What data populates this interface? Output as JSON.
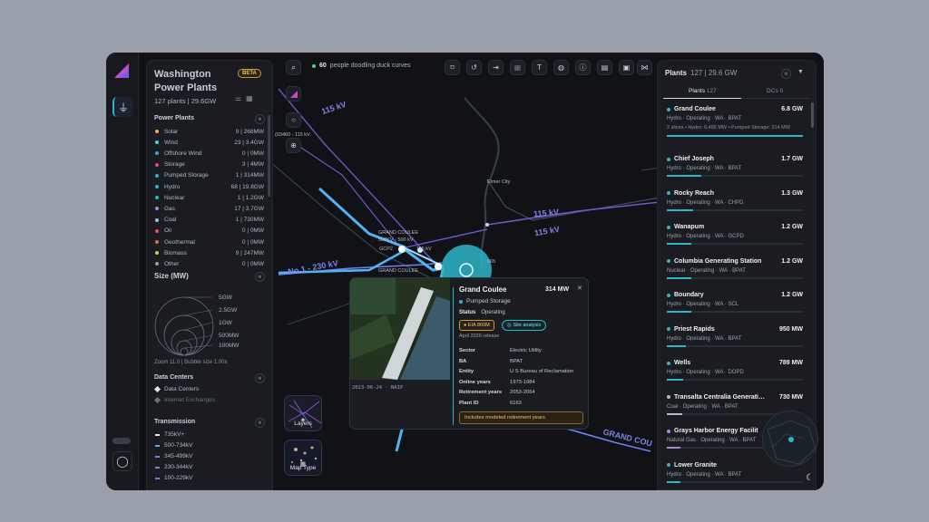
{
  "app": {
    "title_line1": "Washington",
    "title_line2": "Power Plants",
    "beta": "BETA",
    "subtitle": "127 plants | 29.6GW"
  },
  "colors": {
    "accent": "#2bb6c9",
    "transmission": "#7b86e6",
    "warning": "#f0c36a",
    "online": "#3ddc84"
  },
  "rail": {
    "pin_icon": "transmission-tower-icon",
    "user_icon": "user-icon"
  },
  "toolbar": {
    "online_count": "60",
    "online_text": "people doodling duck curves"
  },
  "left_panel": {
    "power_plants_header": "Power Plants",
    "sources": [
      {
        "label": "Solar",
        "value": "9 | 268MW",
        "color": "#f2b233"
      },
      {
        "label": "Wind",
        "value": "23 | 3.4GW",
        "color": "#4fd1e0"
      },
      {
        "label": "Offshore Wind",
        "value": "0 | 0MW",
        "color": "#3fa3d8"
      },
      {
        "label": "Storage",
        "value": "3 | 4MW",
        "color": "#e0479c"
      },
      {
        "label": "Pumped Storage",
        "value": "1 | 314MW",
        "color": "#2bb6c9"
      },
      {
        "label": "Hydro",
        "value": "68 | 19.8GW",
        "color": "#2bb6c9"
      },
      {
        "label": "Nuclear",
        "value": "1 | 1.2GW",
        "color": "#2bb6c9"
      },
      {
        "label": "Gas",
        "value": "17 | 3.7GW",
        "color": "#a786e8"
      },
      {
        "label": "Coal",
        "value": "1 | 730MW",
        "color": "#b7bcc6"
      },
      {
        "label": "Oil",
        "value": "0 | 0MW",
        "color": "#e25555"
      },
      {
        "label": "Geothermal",
        "value": "0 | 0MW",
        "color": "#c97c3a"
      },
      {
        "label": "Biomass",
        "value": "9 | 247MW",
        "color": "#b8d94a"
      },
      {
        "label": "Other",
        "value": "0 | 0MW",
        "color": "#9aa0aa"
      }
    ],
    "size_header": "Size (MW)",
    "size_labels": [
      "5GW",
      "2.5GW",
      "1GW",
      "500MW",
      "100MW"
    ],
    "zoom_text": "Zoom 11.0 | Bubble size 1.00x",
    "dc_header": "Data Centers",
    "dc_items": [
      {
        "label": "Data Centers",
        "color": "#e6e8ee"
      },
      {
        "label": "Internet Exchanges",
        "color": "#6d717b"
      }
    ],
    "tx_header": "Transmission",
    "tx_items": [
      {
        "label": "735kV+",
        "color": "#e6e8ee"
      },
      {
        "label": "500-734kV",
        "color": "#4fb3f5"
      },
      {
        "label": "345-499kV",
        "color": "#6d83f0"
      },
      {
        "label": "230-344kV",
        "color": "#7a7de8"
      },
      {
        "label": "100-229kV",
        "color": "#8a6ae0"
      }
    ]
  },
  "map": {
    "labels": {
      "kv115_a": "115 kV",
      "kv115_b": "115 kV",
      "kv115_c": "115 kV",
      "kv230": "No 1 - 230 kV",
      "grand_coulee_line": "GRAND COU",
      "sub1_a": "GRAND COULEE",
      "sub1_b": "500KV - 500 kV",
      "sub2": "GCP2",
      "sub2_kv": "115 kV",
      "sub3": "GRAND COULEE",
      "small1": "(03460 - 115 kV",
      "city": "Elmer City",
      "num": "065"
    },
    "layers_label": "Layers",
    "map_type_label": "Map Type"
  },
  "popup": {
    "title": "Grand Coulee",
    "capacity": "314 MW",
    "type": "Pumped Storage",
    "status_key": "Status",
    "status_val": "Operating",
    "eia_tag": "EIA 860M",
    "site_tag": "Site analysis",
    "release": "April 2026 release",
    "image_caption": "2023-06-24 · NAIP",
    "fields": [
      {
        "k": "Sector",
        "v": "Electric Utility"
      },
      {
        "k": "BA",
        "v": "BPAT"
      },
      {
        "k": "Entity",
        "v": "U S Bureau of Reclamation"
      },
      {
        "k": "Online years",
        "v": "1973-1984"
      },
      {
        "k": "Retirement years",
        "v": "2053-2064"
      },
      {
        "k": "Plant ID",
        "v": "6163"
      }
    ],
    "note": "Includes modeled retirement years"
  },
  "right_panel": {
    "title": "Plants",
    "title_meta": "127 | 29.6 GW",
    "tab_plants": "Plants",
    "tab_plants_count": "127",
    "tab_dcs": "DCs",
    "tab_dcs_count": "0",
    "plants": [
      {
        "name": "Grand Coulee",
        "cap": "6.8 GW",
        "meta": "Hydro · Operating · WA · BPAT",
        "extra": "2 slices • Hydro: 6,495 MW • Pumped Storage: 314 MW",
        "color": "#2bb6c9",
        "share": 1.0
      },
      {
        "name": "Chief Joseph",
        "cap": "1.7 GW",
        "meta": "Hydro · Operating · WA · BPAT",
        "extra": "",
        "color": "#2bb6c9",
        "share": 0.25
      },
      {
        "name": "Rocky Reach",
        "cap": "1.3 GW",
        "meta": "Hydro · Operating · WA · CHPD",
        "extra": "",
        "color": "#2bb6c9",
        "share": 0.19
      },
      {
        "name": "Wanapum",
        "cap": "1.2 GW",
        "meta": "Hydro · Operating · WA · GCPD",
        "extra": "",
        "color": "#2bb6c9",
        "share": 0.18
      },
      {
        "name": "Columbia Generating Station",
        "cap": "1.2 GW",
        "meta": "Nuclear · Operating · WA · BPAT",
        "extra": "",
        "color": "#2bb6c9",
        "share": 0.18
      },
      {
        "name": "Boundary",
        "cap": "1.2 GW",
        "meta": "Hydro · Operating · WA · SCL",
        "extra": "",
        "color": "#2bb6c9",
        "share": 0.18
      },
      {
        "name": "Priest Rapids",
        "cap": "950 MW",
        "meta": "Hydro · Operating · WA · BPAT",
        "extra": "",
        "color": "#2bb6c9",
        "share": 0.14
      },
      {
        "name": "Wells",
        "cap": "789 MW",
        "meta": "Hydro · Operating · WA · DOPD",
        "extra": "",
        "color": "#2bb6c9",
        "share": 0.12
      },
      {
        "name": "Transalta Centralia Generati…",
        "cap": "730 MW",
        "meta": "Coal · Operating · WA · BPAT",
        "extra": "",
        "color": "#b7bcc6",
        "share": 0.11
      },
      {
        "name": "Grays Harbor Energy Facilit",
        "cap": "",
        "meta": "Natural Gas · Operating · WA · BPAT",
        "extra": "",
        "color": "#a786e8",
        "share": 0.1
      },
      {
        "name": "Lower Granite",
        "cap": "",
        "meta": "Hydro · Operating · WA · BPAT",
        "extra": "",
        "color": "#2bb6c9",
        "share": 0.1
      }
    ]
  }
}
